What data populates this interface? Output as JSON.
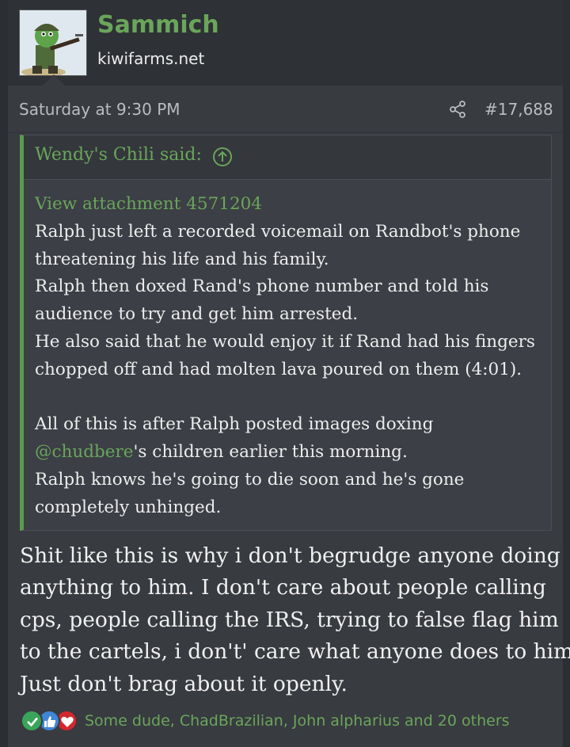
{
  "user": {
    "name": "Sammich",
    "title": "kiwifarms.net"
  },
  "meta": {
    "date": "Saturday at 9:30 PM",
    "post_number": "#17,688"
  },
  "quote": {
    "author": "Wendy's Chili said:",
    "attachment_link": "View attachment 4571204",
    "lines": [
      "Ralph just left a recorded voicemail on Randbot's phone",
      "threatening his life and his family.",
      "Ralph then doxed Rand's phone number and told his",
      "audience to try and get him arrested.",
      "He also said that he would enjoy it if Rand had his fingers",
      "chopped off and had molten lava poured on them (4:01)."
    ],
    "para2_line1": "All of this is after Ralph posted images doxing",
    "mention": "@chudbere",
    "para2_line2_rest": "'s children earlier this morning.",
    "para2_line3": "Ralph knows he's going to die soon and he's gone",
    "para2_line4": "completely unhinged."
  },
  "reply": {
    "lines": [
      "Shit like this is why i don't begrudge anyone doing",
      "anything to him. I don't care about people calling",
      "cps, people calling the IRS, trying to false flag him",
      "to the cartels, i don't' care what anyone does to him.",
      "Just don't brag about it openly."
    ]
  },
  "reactions": {
    "icons": [
      "check-agree",
      "thumbs-up-like",
      "heart-love"
    ],
    "summary": "Some dude, ChadBrazilian, John alpharius and 20 others"
  },
  "colors": {
    "accent_green": "#6aa55b",
    "quote_bar": "#5d9a4e",
    "background": "#383b40"
  }
}
